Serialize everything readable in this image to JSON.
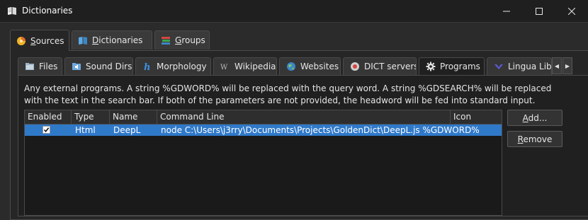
{
  "window": {
    "title": "Dictionaries",
    "minimize_glyph": "—",
    "maximize_glyph": "☐",
    "close_glyph": "✕"
  },
  "main_tabs": [
    {
      "label": "Sources",
      "accel": "S",
      "rest": "ources",
      "icon": "sources-icon",
      "active": true
    },
    {
      "label": "Dictionaries",
      "accel": "D",
      "rest": "ictionaries",
      "icon": "book-icon",
      "active": false
    },
    {
      "label": "Groups",
      "accel": "G",
      "rest": "roups",
      "icon": "books-stack-icon",
      "active": false
    }
  ],
  "source_tabs": [
    {
      "label": "Files",
      "icon": "folder-icon"
    },
    {
      "label": "Sound Dirs",
      "icon": "sound-dirs-icon"
    },
    {
      "label": "Morphology",
      "icon": "hunspell-icon"
    },
    {
      "label": "Wikipedia",
      "icon": "wikipedia-icon"
    },
    {
      "label": "Websites",
      "icon": "globe-icon"
    },
    {
      "label": "DICT servers",
      "icon": "dict-server-icon"
    },
    {
      "label": "Programs",
      "icon": "gear-icon",
      "active": true
    },
    {
      "label": "Lingua Libre",
      "icon": "lingua-libre-icon"
    }
  ],
  "description": "Any external programs. A string %GDWORD% will be replaced with the query word. A string %GDSEARCH% will be replaced with the text in the search bar. If both of the parameters are not provided, the headword will be fed into standard input.",
  "table": {
    "columns": [
      "Enabled",
      "Type",
      "Name",
      "Command Line",
      "Icon"
    ],
    "rows": [
      {
        "enabled": true,
        "type": "Html",
        "name": "DeepL",
        "command": "node C:\\Users\\j3rry\\Documents\\Projects\\GoldenDict\\DeepL.js %GDWORD%",
        "icon": ""
      }
    ]
  },
  "buttons": {
    "add": {
      "label": "Add...",
      "accel": "A",
      "rest": "dd..."
    },
    "remove": {
      "label": "Remove",
      "accel": "R",
      "rest": "emove"
    }
  },
  "colors": {
    "selection": "#2f79c9",
    "background": "#202020"
  }
}
